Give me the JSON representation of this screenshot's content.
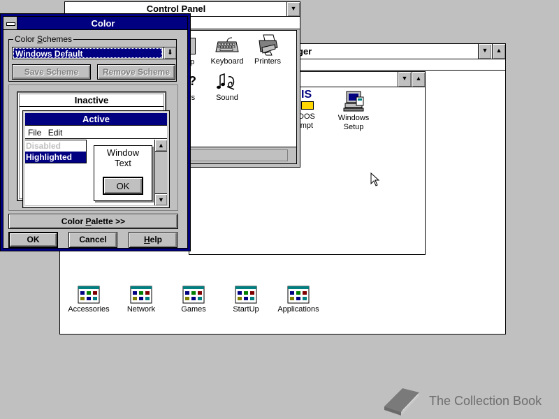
{
  "control_panel": {
    "title": "Control Panel",
    "icons": [
      {
        "label": "Keyboard",
        "icon": "keyboard-icon"
      },
      {
        "label": "Printers",
        "icon": "printer-icon"
      },
      {
        "label": "Sound",
        "icon": "sound-icon"
      }
    ],
    "partial_labels": {
      "desktop_fragment": "op",
      "fonts_fragment": "rs"
    }
  },
  "program_manager": {
    "title_fragment": "ger",
    "groups": [
      {
        "label": "Accessories"
      },
      {
        "label": "Network"
      },
      {
        "label": "Games"
      },
      {
        "label": "StartUp"
      },
      {
        "label": "Applications"
      }
    ]
  },
  "main_group": {
    "items": [
      {
        "label_line1": "DOS",
        "label_line2": "mpt",
        "prefix": "IS"
      },
      {
        "label_line1": "Windows",
        "label_line2": "Setup"
      }
    ]
  },
  "color_dialog": {
    "title": "Color",
    "schemes_label_pre": "Color ",
    "schemes_label_u": "S",
    "schemes_label_post": "chemes",
    "selected_scheme": "Windows Default",
    "save_scheme": "Save Scheme",
    "remove_scheme": "Remove Scheme",
    "preview": {
      "inactive_title": "Inactive",
      "active_title": "Active",
      "menu_file": "File",
      "menu_edit": "Edit",
      "disabled": "Disabled",
      "highlighted": "Highlighted",
      "window_text_line1": "Window",
      "window_text_line2": "Text",
      "ok": "OK"
    },
    "palette_pre": "Color ",
    "palette_u": "P",
    "palette_post": "alette >>",
    "ok": "OK",
    "cancel": "Cancel",
    "help_u": "H",
    "help_post": "elp"
  },
  "watermark": {
    "text": "The Collection Book",
    "icon": "book-icon"
  },
  "colors": {
    "desktop": "#c0c0c0",
    "active_title": "#000080",
    "highlight": "#000080"
  }
}
